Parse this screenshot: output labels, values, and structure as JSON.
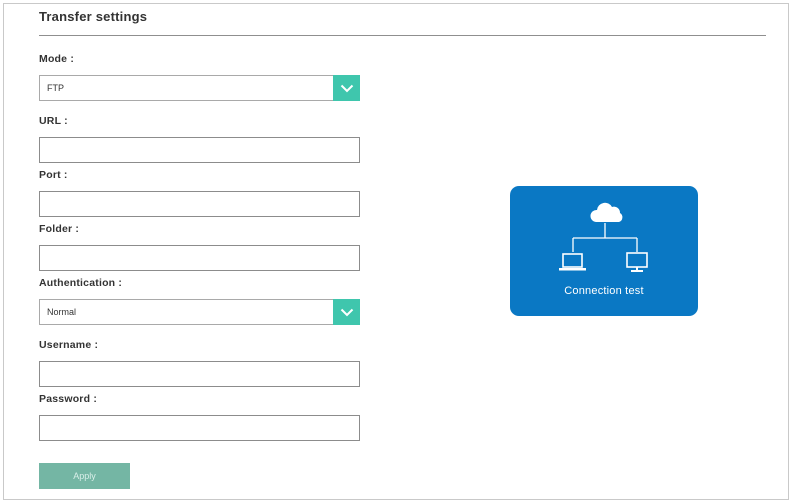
{
  "section": {
    "title": "Transfer settings"
  },
  "fields": {
    "mode_label": "Mode :",
    "mode_value": "FTP",
    "url_label": "URL :",
    "url_value": "",
    "port_label": "Port :",
    "port_value": "",
    "folder_label": "Folder :",
    "folder_value": "",
    "auth_label": "Authentication :",
    "auth_value": "Normal",
    "username_label": "Username :",
    "username_value": "",
    "password_label": "Password :",
    "password_value": ""
  },
  "actions": {
    "apply_label": "Apply",
    "connection_test_label": "Connection test"
  },
  "icons": {
    "select_arrow": "chevron-down-icon",
    "connection": "cloud-network-icon"
  },
  "colors": {
    "accent_green": "#3fc6ad",
    "apply_disabled": "#74b6a4",
    "card_blue": "#0a78c4"
  }
}
